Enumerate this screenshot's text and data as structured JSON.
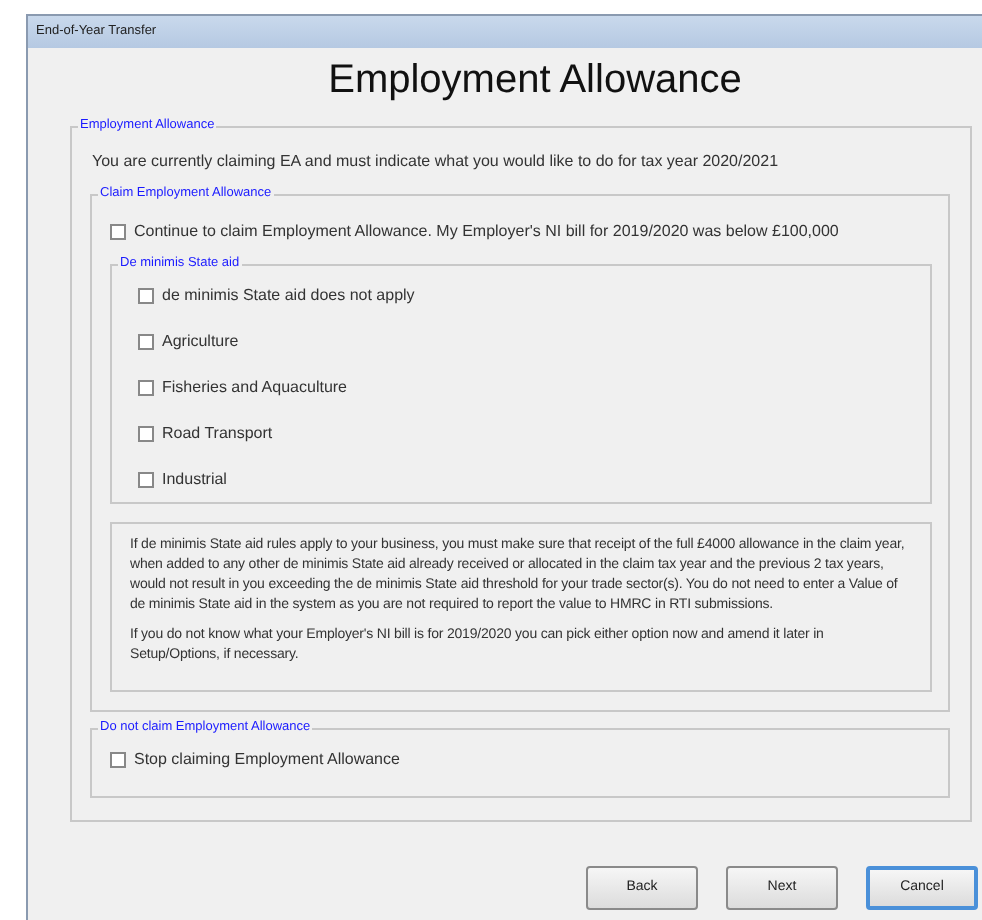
{
  "window": {
    "title": "End-of-Year Transfer"
  },
  "heading": "Employment Allowance",
  "employment_allowance": {
    "legend": "Employment Allowance",
    "intro": "You are currently claiming EA and must indicate what you would like to do for tax year 2020/2021",
    "claim": {
      "legend": "Claim Employment Allowance",
      "continue": {
        "label": "Continue to claim Employment Allowance. My Employer's NI bill for 2019/2020 was below £100,000",
        "checked": false
      },
      "de_minimis": {
        "legend": "De minimis State aid",
        "options": [
          {
            "label": "de minimis State aid does not apply",
            "checked": false
          },
          {
            "label": "Agriculture",
            "checked": false
          },
          {
            "label": "Fisheries and Aquaculture",
            "checked": false
          },
          {
            "label": "Road Transport",
            "checked": false
          },
          {
            "label": "Industrial",
            "checked": false
          }
        ]
      },
      "info": [
        "If de minimis State aid rules apply to your business, you must make sure that receipt of the full £4000 allowance in the claim year, when added to any other de minimis State aid already received or allocated in the claim tax year and the previous 2 tax years, would not result in you exceeding the de minimis State aid threshold for your trade sector(s). You do not need to enter a Value of de minimis State aid in the system as you are not required to report the value to HMRC in RTI submissions.",
        "If you do not know what your Employer's NI bill is for 2019/2020 you can pick either option now and amend it later in Setup/Options, if necessary."
      ]
    },
    "do_not_claim": {
      "legend": "Do not claim Employment Allowance",
      "stop": {
        "label": "Stop claiming Employment Allowance",
        "checked": false
      }
    }
  },
  "buttons": [
    {
      "label": "Back",
      "default": false
    },
    {
      "label": "Next",
      "default": false
    },
    {
      "label": "Cancel",
      "default": true
    }
  ]
}
